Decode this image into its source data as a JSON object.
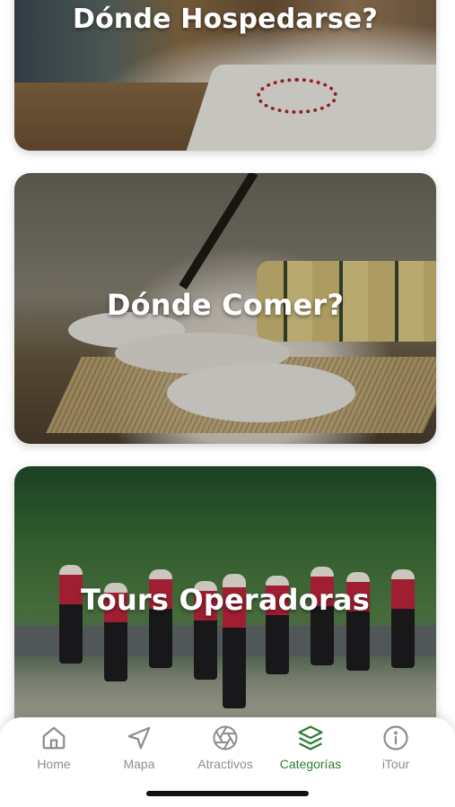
{
  "cards": [
    {
      "title": "Dónde Hospedarse?"
    },
    {
      "title": "Dónde Comer?"
    },
    {
      "title": "Tours Operadoras"
    }
  ],
  "nav": {
    "items": [
      {
        "label": "Home",
        "icon": "home-icon",
        "active": false
      },
      {
        "label": "Mapa",
        "icon": "navigation-arrow-icon",
        "active": false
      },
      {
        "label": "Atractivos",
        "icon": "aperture-icon",
        "active": false
      },
      {
        "label": "Categorías",
        "icon": "layers-icon",
        "active": true
      },
      {
        "label": "iTour",
        "icon": "info-icon",
        "active": false
      }
    ],
    "active_color": "#2e7d32",
    "inactive_color": "#8d8d8d"
  }
}
